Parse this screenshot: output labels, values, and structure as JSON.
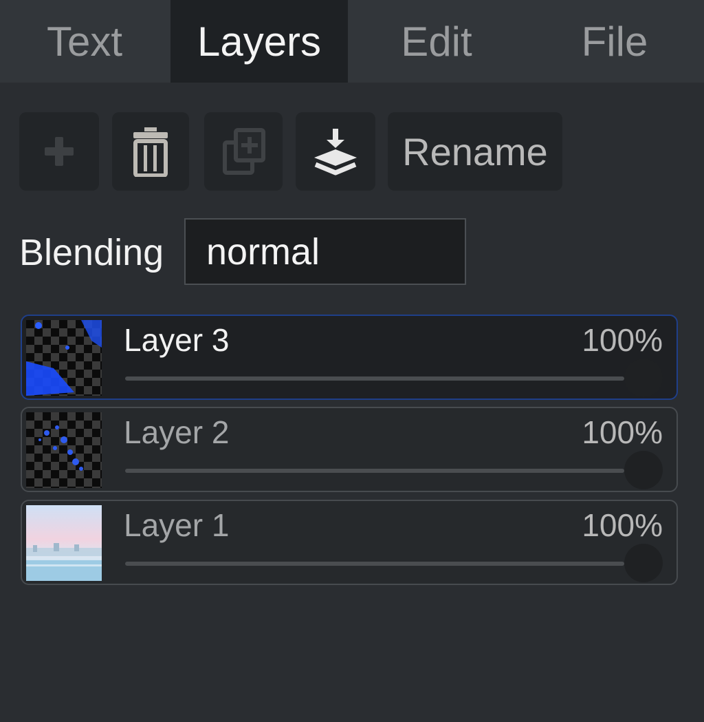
{
  "tabs": [
    {
      "label": "Text",
      "active": false
    },
    {
      "label": "Layers",
      "active": true
    },
    {
      "label": "Edit",
      "active": false
    },
    {
      "label": "File",
      "active": false
    }
  ],
  "toolbar": {
    "add_icon": "plus-icon",
    "delete_icon": "trash-icon",
    "duplicate_icon": "duplicate-icon",
    "merge_down_icon": "merge-down-icon",
    "rename_label": "Rename"
  },
  "blending": {
    "label": "Blending",
    "value": "normal"
  },
  "layers": [
    {
      "name": "Layer 3",
      "opacity_label": "100%",
      "opacity": 100,
      "selected": true
    },
    {
      "name": "Layer 2",
      "opacity_label": "100%",
      "opacity": 100,
      "selected": false
    },
    {
      "name": "Layer 1",
      "opacity_label": "100%",
      "opacity": 100,
      "selected": false
    }
  ],
  "colors": {
    "background": "#2a2d31",
    "tabbar": "#32363a",
    "active_tab": "#1e2124",
    "selected_layer_border": "#1f3f8a",
    "layer_paint_blue": "#1a4bff"
  }
}
